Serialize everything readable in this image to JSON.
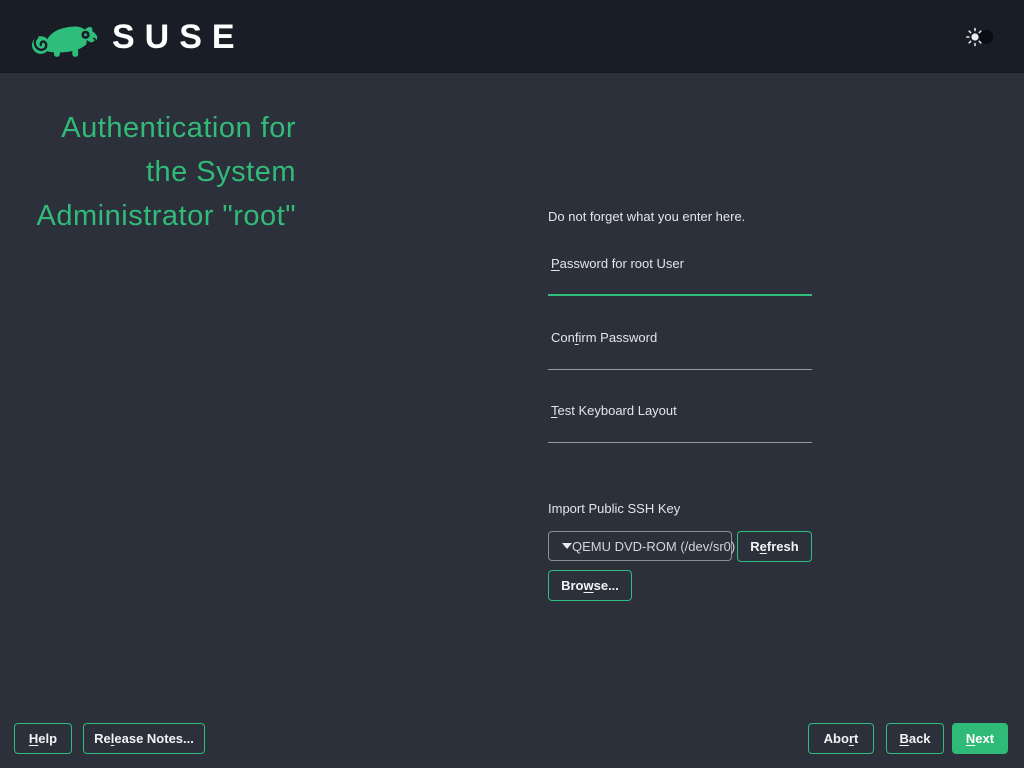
{
  "colors": {
    "accent_green": "#30ba78",
    "heading_green": "#32ba79",
    "header_bg": "#191d26",
    "page_bg": "#2b303a",
    "focus_underline": "#2fbd7b"
  },
  "header": {
    "brand": "SUSE",
    "logo_icon": "suse-chameleon",
    "theme_toggle_icon": "light-dark-toggle"
  },
  "heading": {
    "lines": [
      "Authentication for",
      "the System",
      "Administrator \"root\""
    ]
  },
  "form": {
    "hint": "Do not forget what you enter here.",
    "fields": [
      {
        "label_pre": "",
        "label_key": "P",
        "label_post": "assword for root User",
        "value": "",
        "focused": true
      },
      {
        "label_pre": "Con",
        "label_key": "f",
        "label_post": "irm Password",
        "value": "",
        "focused": false
      },
      {
        "label_pre": "",
        "label_key": "T",
        "label_post": "est Keyboard Layout",
        "value": "",
        "focused": false
      }
    ],
    "ssh": {
      "label": "Import Public SSH Key",
      "combo_value": "QEMU DVD-ROM (/dev/sr0)",
      "combo_arrow_icon": "chevron-down",
      "refresh": {
        "pre": "R",
        "key": "e",
        "post": "fresh"
      },
      "browse": {
        "pre": "Bro",
        "key": "w",
        "post": "se..."
      }
    }
  },
  "footer": {
    "help": {
      "pre": "",
      "key": "H",
      "post": "elp"
    },
    "release_notes": {
      "pre": "Re",
      "key": "l",
      "post": "ease Notes..."
    },
    "abort": {
      "pre": "Abo",
      "key": "r",
      "post": "t"
    },
    "back": {
      "pre": "",
      "key": "B",
      "post": "ack"
    },
    "next": {
      "pre": "",
      "key": "N",
      "post": "ext"
    }
  }
}
